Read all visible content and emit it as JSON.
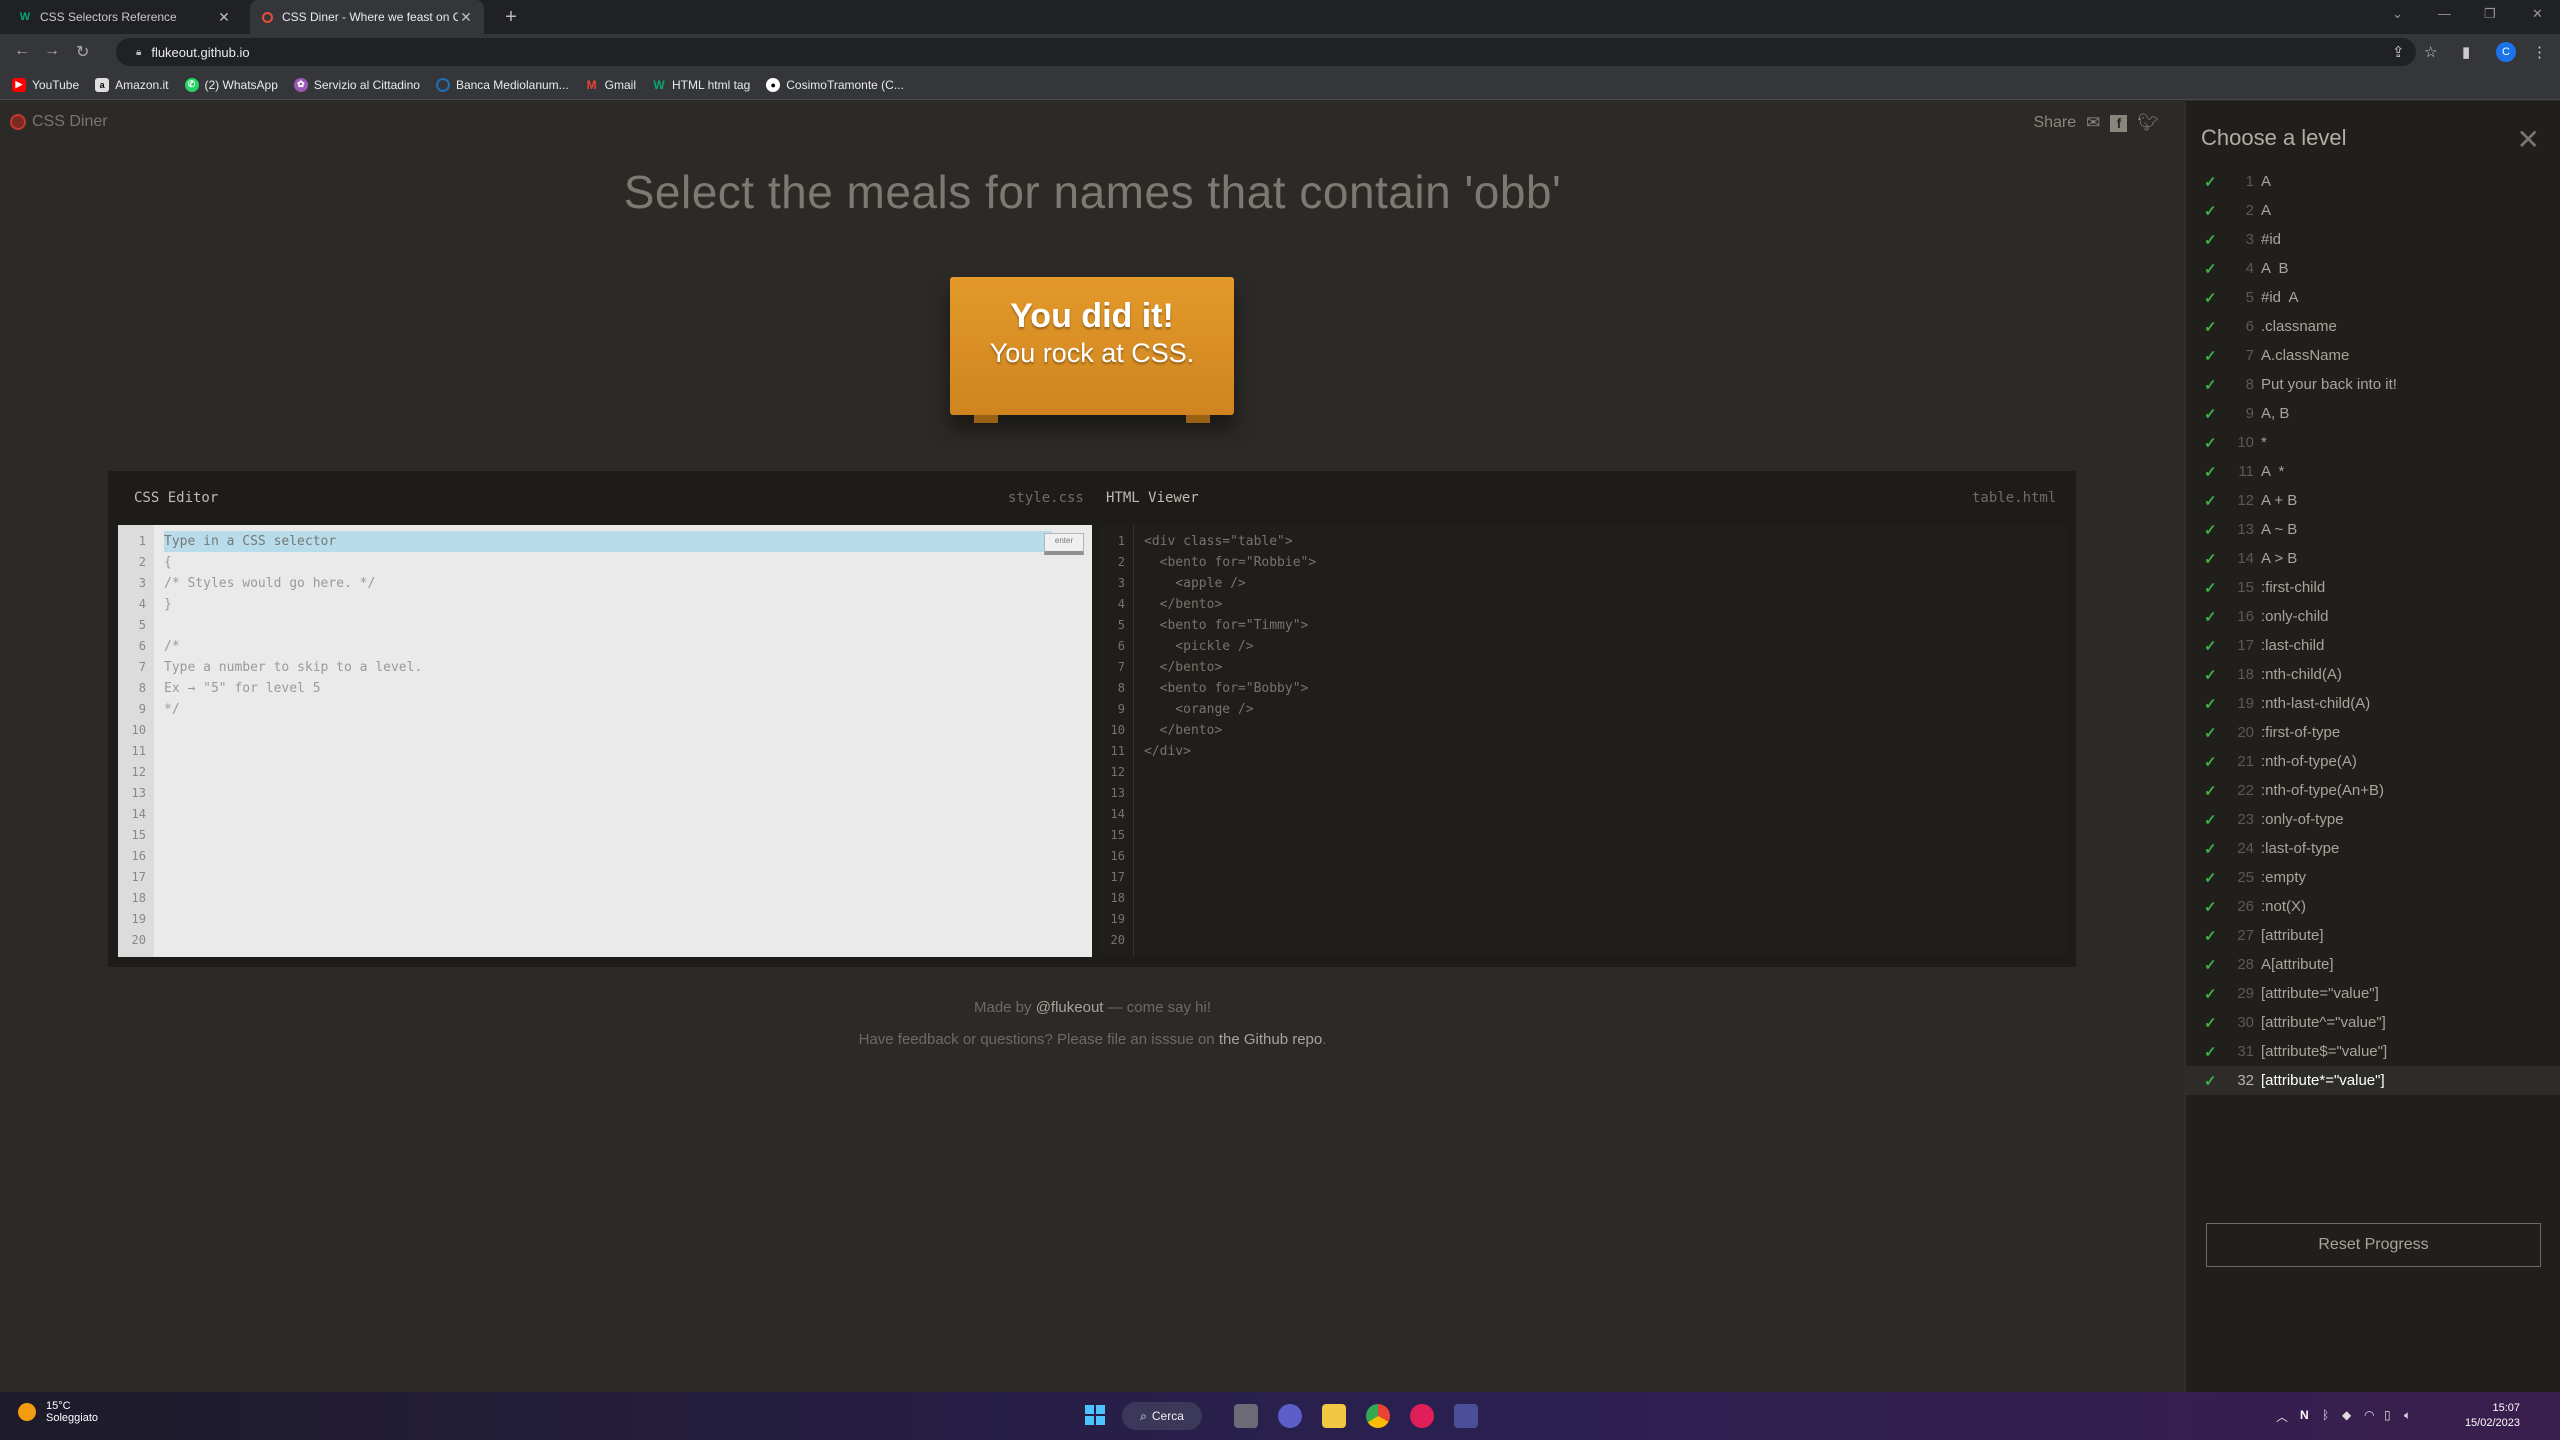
{
  "browser": {
    "tabs": [
      {
        "title": "CSS Selectors Reference",
        "icon": "w3schools-icon",
        "active": false
      },
      {
        "title": "CSS Diner - Where we feast on C",
        "icon": "css-diner-icon",
        "active": true
      }
    ],
    "url": "flukeout.github.io",
    "profile_initial": "C",
    "bookmarks": [
      {
        "label": "YouTube",
        "icon": "youtube-icon",
        "color": "#ff0000"
      },
      {
        "label": "Amazon.it",
        "icon": "amazon-icon",
        "color": "#333333"
      },
      {
        "label": "(2) WhatsApp",
        "icon": "whatsapp-icon",
        "color": "#25d366"
      },
      {
        "label": "Servizio al Cittadino",
        "icon": "bookmark-icon",
        "color": "#9b59b6"
      },
      {
        "label": "Banca Mediolanum...",
        "icon": "bank-icon",
        "color": "#1f6fb2"
      },
      {
        "label": "Gmail",
        "icon": "gmail-icon",
        "color": "#ea4335"
      },
      {
        "label": "HTML html tag",
        "icon": "w3schools-icon",
        "color": "#04aa6d"
      },
      {
        "label": "CosimoTramonte (C...",
        "icon": "github-icon",
        "color": "#ffffff"
      }
    ]
  },
  "app": {
    "logo": "CSS Diner",
    "share_label": "Share",
    "instruction": "Select the meals for names that contain 'obb'",
    "win_line1": "You did it!",
    "win_line2": "You rock at CSS."
  },
  "editor": {
    "title": "CSS Editor",
    "file": "style.css",
    "placeholder": "Type in a CSS selector",
    "enter_label": "enter",
    "lines": [
      "",
      "{",
      "/* Styles would go here. */",
      "}",
      "",
      "/*",
      "Type a number to skip to a level.",
      "Ex → \"5\" for level 5",
      "*/",
      "",
      "",
      "",
      "",
      "",
      "",
      "",
      "",
      "",
      "",
      ""
    ]
  },
  "viewer": {
    "title": "HTML Viewer",
    "file": "table.html",
    "lines": [
      "<div class=\"table\">",
      "  <bento for=\"Robbie\">",
      "    <apple />",
      "  </bento>",
      "  <bento for=\"Timmy\">",
      "    <pickle />",
      "  </bento>",
      "  <bento for=\"Bobby\">",
      "    <orange />",
      "  </bento>",
      "</div>",
      "",
      "",
      "",
      "",
      "",
      "",
      "",
      "",
      ""
    ]
  },
  "line_numbers": [
    "1",
    "2",
    "3",
    "4",
    "5",
    "6",
    "7",
    "8",
    "9",
    "10",
    "11",
    "12",
    "13",
    "14",
    "15",
    "16",
    "17",
    "18",
    "19",
    "20"
  ],
  "footer": {
    "made_by_pre": "Made by ",
    "made_by_link": "@flukeout",
    "made_by_post": " — come say hi!",
    "feedback_pre": "Have feedback or questions? Please file an isssue on ",
    "feedback_link": "the Github repo",
    "feedback_post": "."
  },
  "sidebar": {
    "title": "Choose a level",
    "reset_label": "Reset Progress",
    "current_level": "32",
    "levels": [
      {
        "num": "1",
        "name": "A"
      },
      {
        "num": "2",
        "name": "A"
      },
      {
        "num": "3",
        "name": "#id"
      },
      {
        "num": "4",
        "name": "A  B"
      },
      {
        "num": "5",
        "name": "#id  A"
      },
      {
        "num": "6",
        "name": ".classname"
      },
      {
        "num": "7",
        "name": "A.className"
      },
      {
        "num": "8",
        "name": "Put your back into it!"
      },
      {
        "num": "9",
        "name": "A, B"
      },
      {
        "num": "10",
        "name": "*"
      },
      {
        "num": "11",
        "name": "A  *"
      },
      {
        "num": "12",
        "name": "A + B"
      },
      {
        "num": "13",
        "name": "A ~ B"
      },
      {
        "num": "14",
        "name": "A > B"
      },
      {
        "num": "15",
        "name": ":first-child"
      },
      {
        "num": "16",
        "name": ":only-child"
      },
      {
        "num": "17",
        "name": ":last-child"
      },
      {
        "num": "18",
        "name": ":nth-child(A)"
      },
      {
        "num": "19",
        "name": ":nth-last-child(A)"
      },
      {
        "num": "20",
        "name": ":first-of-type"
      },
      {
        "num": "21",
        "name": ":nth-of-type(A)"
      },
      {
        "num": "22",
        "name": ":nth-of-type(An+B)"
      },
      {
        "num": "23",
        "name": ":only-of-type"
      },
      {
        "num": "24",
        "name": ":last-of-type"
      },
      {
        "num": "25",
        "name": ":empty"
      },
      {
        "num": "26",
        "name": ":not(X)"
      },
      {
        "num": "27",
        "name": "[attribute]"
      },
      {
        "num": "28",
        "name": "A[attribute]"
      },
      {
        "num": "29",
        "name": "[attribute=\"value\"]"
      },
      {
        "num": "30",
        "name": "[attribute^=\"value\"]"
      },
      {
        "num": "31",
        "name": "[attribute$=\"value\"]"
      },
      {
        "num": "32",
        "name": "[attribute*=\"value\"]"
      }
    ]
  },
  "taskbar": {
    "temperature": "15°C",
    "weather": "Soleggiato",
    "search_label": "Cerca",
    "time": "15:07",
    "date": "15/02/2023"
  }
}
